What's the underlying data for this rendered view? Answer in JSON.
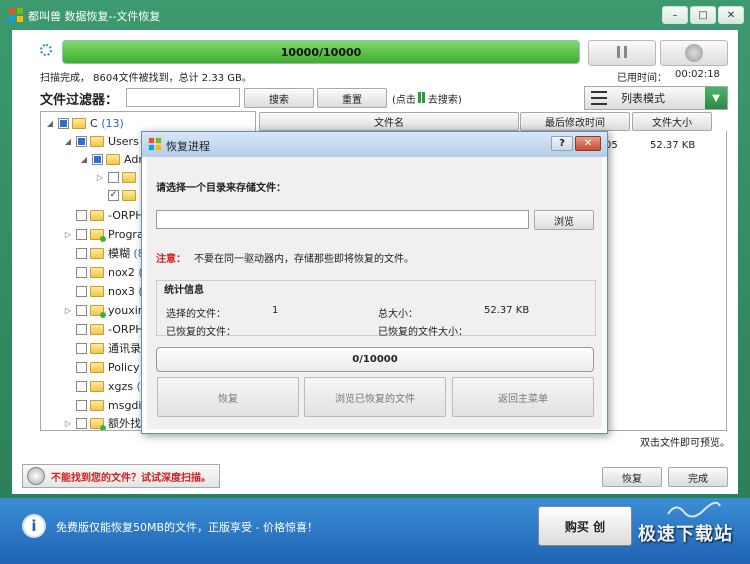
{
  "window": {
    "title": "都叫兽 数据恢复--文件恢复",
    "minimize": "–",
    "maximize": "□",
    "close": "✕"
  },
  "scan": {
    "progress_text": "10000/10000",
    "progress_fraction": 1.0,
    "status": "扫描完成， 8604文件被找到，总计 2.33 GB。",
    "elapsed_label": "已用时间：",
    "elapsed_value": "00:02:18"
  },
  "filter": {
    "label": "文件过滤器：",
    "input_value": "",
    "search_label": "搜索",
    "reset_label": "重置",
    "hint_prefix": "(点击",
    "hint_suffix": "去搜索)"
  },
  "view_mode": {
    "label": "列表模式",
    "arrow": "▼"
  },
  "tree": {
    "items": [
      {
        "label": "C",
        "count": "(13)"
      },
      {
        "label": "Users",
        "count": ""
      },
      {
        "label": "Adr",
        "count": ""
      },
      {
        "label": "",
        "count": ""
      },
      {
        "label": "",
        "count": ""
      },
      {
        "label": "-ORPH",
        "count": ""
      },
      {
        "label": "Progra",
        "count": ""
      },
      {
        "label": "模糊",
        "count": "(8"
      },
      {
        "label": "nox2",
        "count": "("
      },
      {
        "label": "nox3",
        "count": "("
      },
      {
        "label": "youxin",
        "count": ""
      },
      {
        "label": "-ORPH",
        "count": ""
      },
      {
        "label": "通讯录",
        "count": ""
      },
      {
        "label": "Policy",
        "count": "("
      },
      {
        "label": "xgzs",
        "count": "(3"
      },
      {
        "label": "msgdir",
        "count": ""
      },
      {
        "label": "额外找到",
        "count": ""
      }
    ]
  },
  "file_list": {
    "columns": {
      "name": "文件名",
      "date": "最后修改时间",
      "size": "文件大小"
    },
    "rows": [
      {
        "date_fragment": "05",
        "size": "52.37 KB"
      }
    ],
    "dblclick_hint": "双击文件即可预览。"
  },
  "bottom": {
    "deep_scan_label": "不能找到您的文件？试试深度扫描。",
    "recover_label": "恢复",
    "finish_label": "完成"
  },
  "footer": {
    "info_glyph": "i",
    "text": "免费版仅能恢复50MB的文件，正版享受 - 价格惊喜！",
    "buy_label": "购买 创",
    "watermark": "极速下载站"
  },
  "dialog": {
    "title": "恢复进程",
    "help": "?",
    "close": "✕",
    "prompt": "请选择一个目录来存储文件：",
    "path_value": "",
    "browse_label": "浏览",
    "note_label": "注意：",
    "note_text": "不要在同一驱动器内，存储那些即将恢复的文件。",
    "stats_title": "统计信息",
    "selected_files_label": "选择的文件：",
    "selected_files_value": "1",
    "total_size_label": "总大小：",
    "total_size_value": "52.37 KB",
    "recovered_files_label": "已恢复的文件：",
    "recovered_size_label": "已恢复的文件大小：",
    "progress_text": "0/10000",
    "recover_label": "恢复",
    "browse_recovered_label": "浏览已恢复的文件",
    "return_label": "返回主菜单"
  },
  "colors": {
    "frame": "#2a7d57",
    "progress_green": "#3fae2c",
    "footer_blue": "#1f63b3",
    "warning_red": "#d02020"
  }
}
